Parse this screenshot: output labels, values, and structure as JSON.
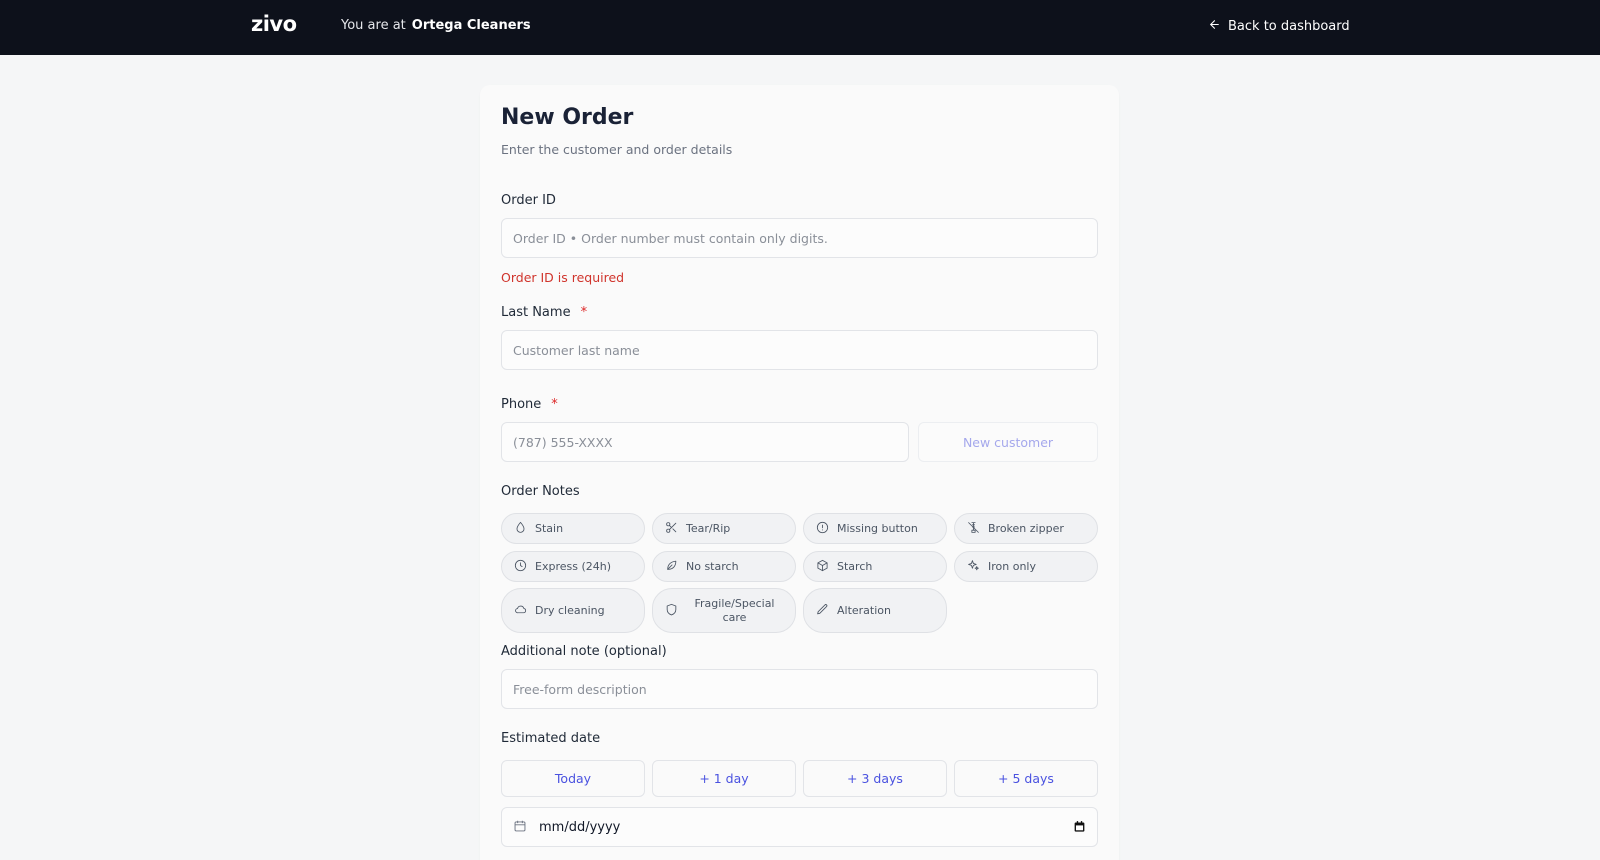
{
  "topbar": {
    "logo": "zivo",
    "location_prefix": "You are at",
    "location_name": "Ortega Cleaners",
    "back_label": "Back to dashboard"
  },
  "form": {
    "title": "New Order",
    "subtitle": "Enter the customer and order details",
    "order_id": {
      "label": "Order ID",
      "placeholder": "Order ID • Order number must contain only digits.",
      "value": "",
      "error": "Order ID is required"
    },
    "last_name": {
      "label": "Last Name",
      "required_mark": "*",
      "placeholder": "Customer last name",
      "value": ""
    },
    "phone": {
      "label": "Phone",
      "required_mark": "*",
      "placeholder": "(787) 555-XXXX",
      "value": "",
      "new_customer_label": "New customer"
    },
    "order_notes": {
      "label": "Order Notes",
      "chips": [
        {
          "label": "Stain",
          "icon": "droplet-icon"
        },
        {
          "label": "Tear/Rip",
          "icon": "scissors-icon"
        },
        {
          "label": "Missing button",
          "icon": "alert-circle-icon"
        },
        {
          "label": "Broken zipper",
          "icon": "zipper-off-icon"
        },
        {
          "label": "Express (24h)",
          "icon": "clock-icon"
        },
        {
          "label": "No starch",
          "icon": "leaf-icon"
        },
        {
          "label": "Starch",
          "icon": "box-icon"
        },
        {
          "label": "Iron only",
          "icon": "sparkles-icon"
        },
        {
          "label": "Dry cleaning",
          "icon": "cloud-icon"
        },
        {
          "label": "Fragile/Special care",
          "icon": "shield-icon"
        },
        {
          "label": "Alteration",
          "icon": "pencil-icon"
        }
      ]
    },
    "additional_note": {
      "label": "Additional note (optional)",
      "placeholder": "Free-form description",
      "value": ""
    },
    "estimated_date": {
      "label": "Estimated date",
      "quick_buttons": [
        "Today",
        "+ 1 day",
        "+ 3 days",
        "+ 5 days"
      ],
      "date_placeholder": "mm/dd/yyyy"
    }
  },
  "colors": {
    "topbar_bg": "#0d111b",
    "accent": "#4a52e0",
    "error": "#d0342c",
    "required": "#dc2626"
  }
}
